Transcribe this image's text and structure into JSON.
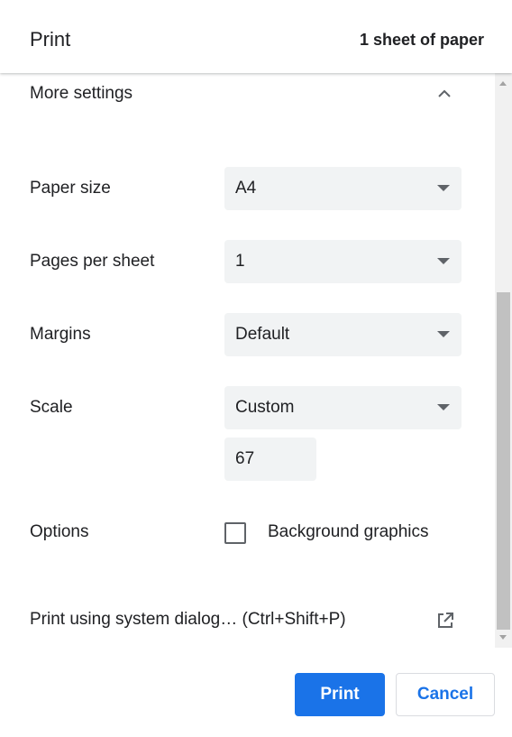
{
  "header": {
    "title": "Print",
    "sheet_count": "1 sheet of paper"
  },
  "more_settings": {
    "label": "More settings",
    "icon": "chevron-up-icon"
  },
  "settings": {
    "paper_size": {
      "label": "Paper size",
      "value": "A4"
    },
    "pages_per_sheet": {
      "label": "Pages per sheet",
      "value": "1"
    },
    "margins": {
      "label": "Margins",
      "value": "Default"
    },
    "scale": {
      "label": "Scale",
      "value": "Custom",
      "custom_value": "67"
    },
    "options": {
      "label": "Options",
      "background_graphics_label": "Background graphics",
      "background_graphics_checked": false
    }
  },
  "system_dialog": {
    "label": "Print using system dialog… (Ctrl+Shift+P)",
    "icon": "open-in-new-icon"
  },
  "footer": {
    "print_label": "Print",
    "cancel_label": "Cancel"
  },
  "colors": {
    "accent": "#1a73e8",
    "field_background": "#f1f3f4",
    "text": "#202124"
  }
}
